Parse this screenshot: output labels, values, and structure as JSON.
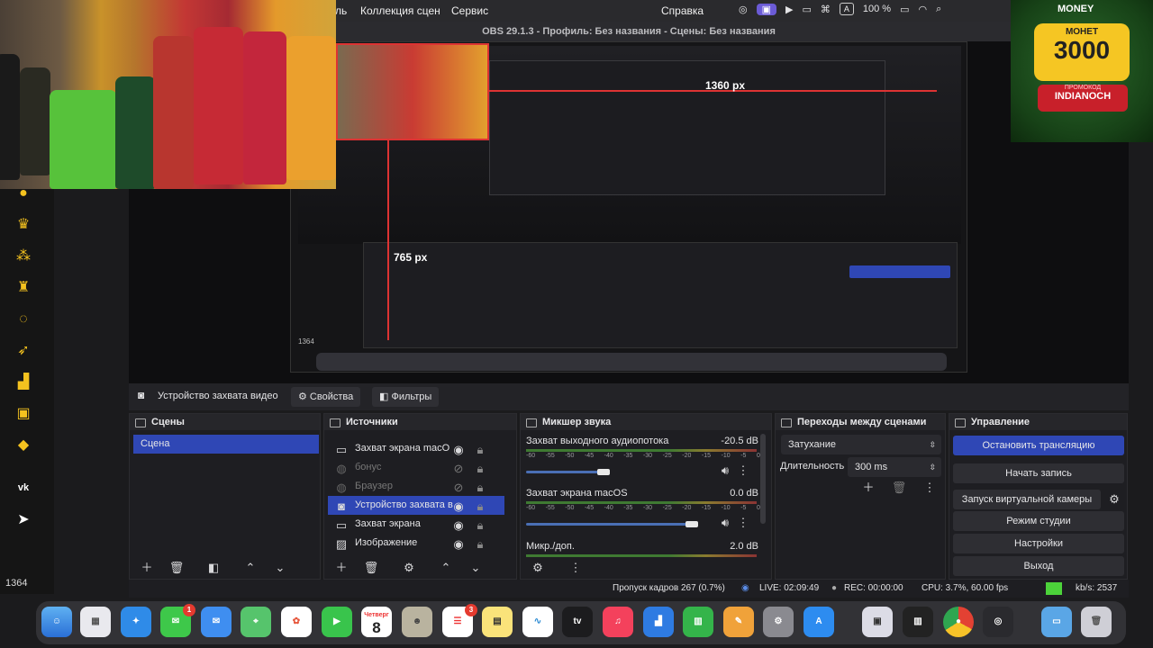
{
  "menubar": {
    "items": [
      "ль",
      "Коллекция сцен",
      "Сервис",
      "Справка"
    ],
    "battery": "100 %"
  },
  "window": {
    "title": "OBS 29.1.3 - Профиль: Без названия - Сцены: Без названия"
  },
  "preview": {
    "dim1": "1360 px",
    "dim2": "765 px",
    "counter": "1364"
  },
  "promo": {
    "brand": "MONEY",
    "label": "МОНЕТ",
    "amount": "3000",
    "code_label": "ПРОМОКОД",
    "code": "INDIANOCH"
  },
  "toolbar": {
    "device_label": "Устройство захвата видео",
    "properties": "Свойства",
    "filters": "Фильтры"
  },
  "scenes": {
    "title": "Сцены",
    "items": [
      "Сцена"
    ]
  },
  "sources": {
    "title": "Источники",
    "items": [
      "Захват экрана macO",
      "бонус",
      "Браузер",
      "Устройство захвата в",
      "Захват экрана",
      "Изображение"
    ]
  },
  "mixer": {
    "title": "Микшер звука",
    "ticks": [
      "-60",
      "-55",
      "-50",
      "-45",
      "-40",
      "-35",
      "-30",
      "-25",
      "-20",
      "-15",
      "-10",
      "-5",
      "0"
    ],
    "channels": [
      {
        "name": "Захват выходного аудиопотока",
        "db": "-20.5 dB",
        "level": 0.4
      },
      {
        "name": "Захват экрана macOS",
        "db": "0.0 dB",
        "level": 0.85
      },
      {
        "name": "Микр./доп.",
        "db": "2.0 dB",
        "level": 0.9
      }
    ]
  },
  "transitions": {
    "title": "Переходы между сценами",
    "selected": "Затухание",
    "duration_label": "Длительность",
    "duration_value": "300 ms"
  },
  "controls": {
    "title": "Управление",
    "buttons": [
      "Остановить трансляцию",
      "Начать запись",
      "Запуск виртуальной камеры",
      "Режим студии",
      "Настройки",
      "Выход"
    ]
  },
  "status": {
    "dropped": "Пропуск кадров 267 (0.7%)",
    "live": "LIVE: 02:09:49",
    "rec": "REC: 00:00:00",
    "cpu": "CPU: 3.7%, 60.00 fps",
    "kbs": "kb/s: 2537"
  },
  "sidebar": {
    "counter": "1364"
  },
  "dock": {
    "calendar_day": "Четверг",
    "calendar_date": "8",
    "apps": [
      "Finder",
      "Launchpad",
      "Safari",
      "Messages",
      "Mail",
      "Maps",
      "Photos",
      "FaceTime",
      "Calendar",
      "Contacts",
      "Reminders",
      "Notes",
      "Freeform",
      "TV",
      "Music",
      "Keynote",
      "Numbers",
      "Pages",
      "Settings",
      "App Store",
      "Preview",
      "Piano",
      "Chrome",
      "OBS",
      "Folder",
      "Trash"
    ],
    "badges": {
      "messages": "1",
      "reminders": "3"
    },
    "tv_label": "tv"
  }
}
